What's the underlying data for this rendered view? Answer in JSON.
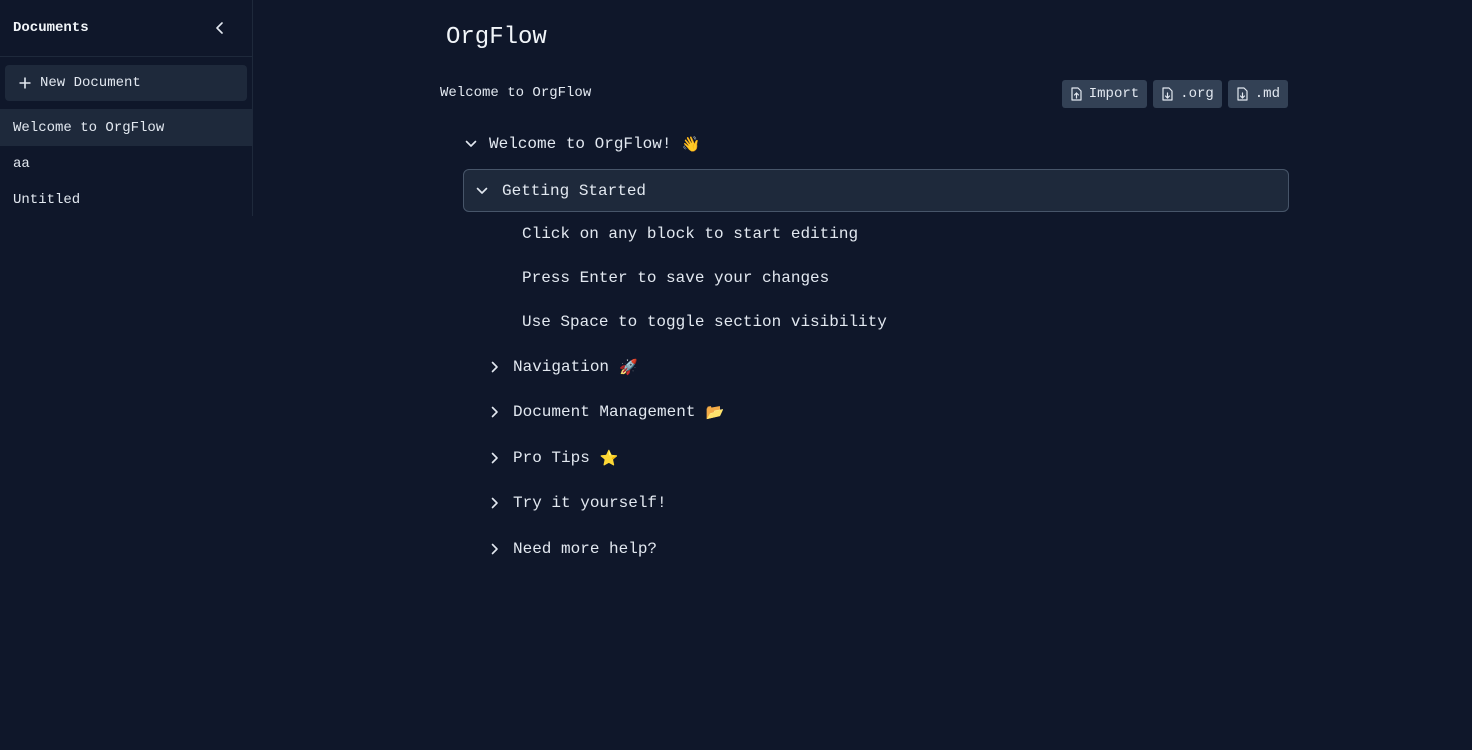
{
  "sidebar": {
    "title": "Documents",
    "new_document_label": "New Document",
    "documents": [
      {
        "label": "Welcome to OrgFlow",
        "active": true
      },
      {
        "label": "aa",
        "active": false
      },
      {
        "label": "Untitled",
        "active": false
      }
    ]
  },
  "main": {
    "app_title": "OrgFlow",
    "document_name": "Welcome to OrgFlow",
    "toolbar": {
      "import_label": "Import",
      "org_label": ".org",
      "md_label": ".md"
    },
    "outline": {
      "root": {
        "label": "Welcome to OrgFlow!",
        "emoji": "👋",
        "expanded": true
      },
      "getting_started": {
        "label": "Getting Started",
        "expanded": true,
        "selected": true
      },
      "getting_started_items": [
        "Click on any block to start editing",
        "Press Enter to save your changes",
        "Use Space to toggle section visibility"
      ],
      "sections": [
        {
          "label": "Navigation",
          "emoji": "🚀"
        },
        {
          "label": "Document Management",
          "emoji": "📂"
        },
        {
          "label": "Pro Tips",
          "emoji": "⭐"
        },
        {
          "label": "Try it yourself!",
          "emoji": ""
        },
        {
          "label": "Need more help?",
          "emoji": ""
        }
      ]
    }
  },
  "colors": {
    "background": "#0f172a",
    "panel": "#1e293b",
    "button": "#334155",
    "text": "#e2e8f0"
  }
}
